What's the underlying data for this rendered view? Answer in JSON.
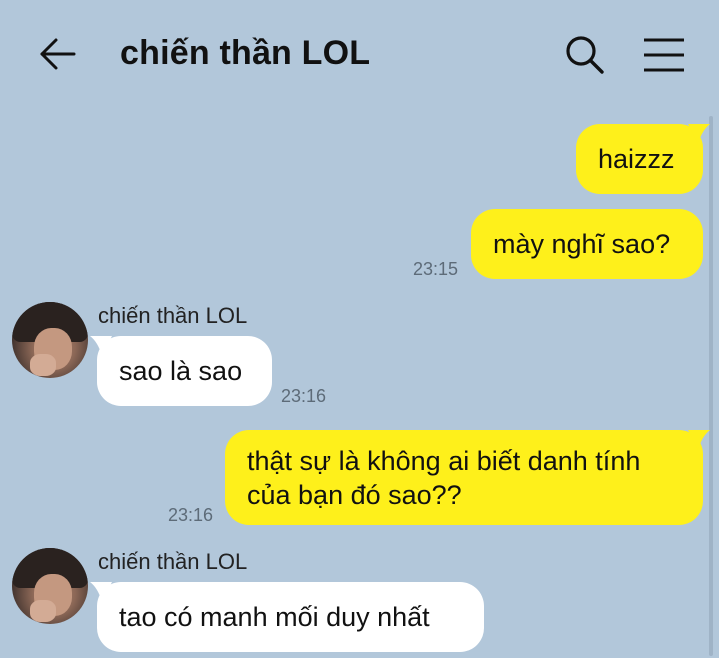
{
  "header": {
    "title": "chiến thần LOL",
    "back_icon": "arrow-left-icon",
    "search_icon": "search-icon",
    "menu_icon": "hamburger-menu-icon"
  },
  "colors": {
    "background": "#b2c7da",
    "outgoing_bubble": "#fef01b",
    "incoming_bubble": "#ffffff"
  },
  "messages": [
    {
      "direction": "out",
      "text": "haizzz"
    },
    {
      "direction": "out",
      "text": "mày nghĩ sao?",
      "time": "23:15"
    },
    {
      "direction": "in",
      "sender": "chiến thần LOL",
      "text": "sao là sao",
      "time": "23:16"
    },
    {
      "direction": "out",
      "lines": [
        "thật sự là không ai biết danh tính",
        "của bạn đó sao??"
      ],
      "time": "23:16"
    },
    {
      "direction": "in",
      "sender": "chiến thần LOL",
      "text": "tao có manh mối duy nhất"
    }
  ]
}
